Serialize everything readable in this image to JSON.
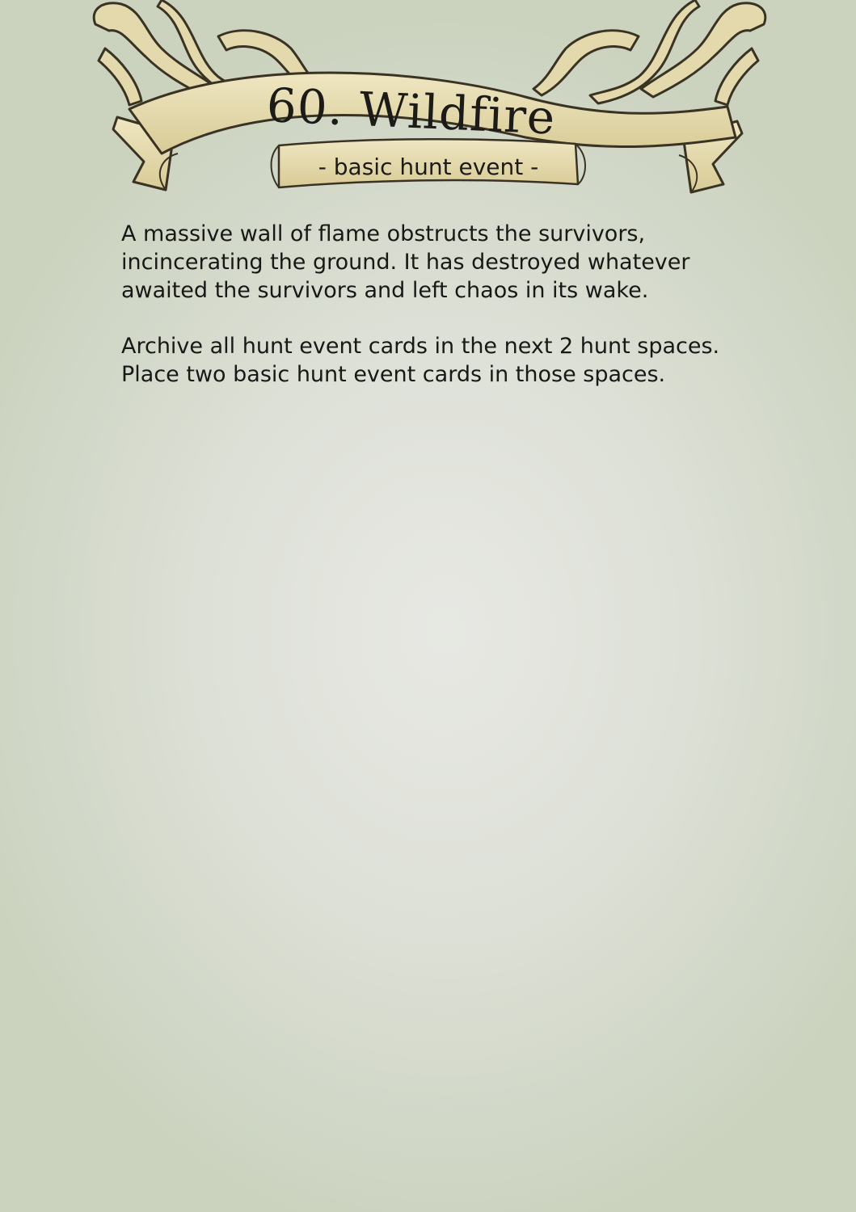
{
  "card": {
    "title": "60. Wildfire",
    "subtitle": "- basic hunt event -",
    "paragraphs": [
      "A massive wall of flame obstructs the survivors, incincerating the ground. It has destroyed whatever awaited the survivors and left chaos in its wake.",
      "Archive all hunt event cards in the next 2 hunt spaces. Place two basic hunt event cards in those spaces."
    ]
  },
  "colors": {
    "background": "#dee1d8",
    "banner": "#e6dcb0",
    "ink": "#1c1b18"
  }
}
